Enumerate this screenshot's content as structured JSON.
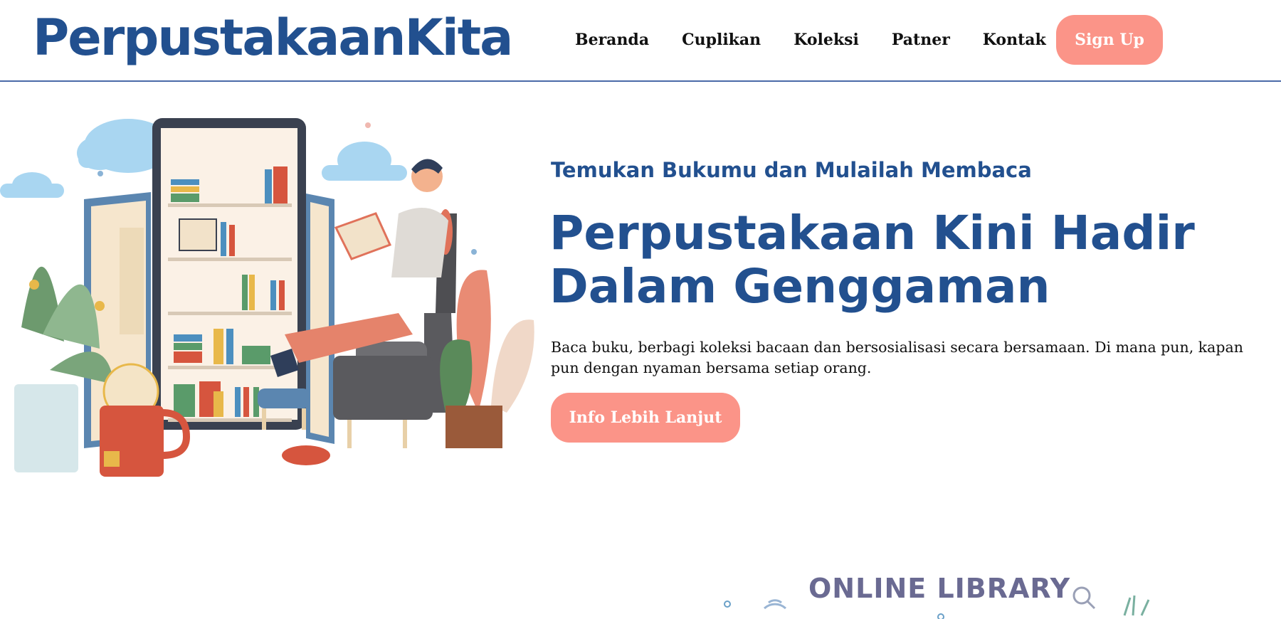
{
  "header": {
    "brand": "PerpustakaanKita",
    "nav": [
      "Beranda",
      "Cuplikan",
      "Koleksi",
      "Patner",
      "Kontak"
    ],
    "signup_label": "Sign Up"
  },
  "hero": {
    "eyebrow": "Temukan Bukumu dan Mulailah Membaca",
    "title": "Perpustakaan Kini Hadir Dalam Genggaman",
    "description": "Baca buku, berbagi koleksi bacaan dan bersosialisasi secara bersamaan. Di mana pun, kapan pun dengan nyaman bersama setiap orang.",
    "cta_label": "Info Lebih Lanjut"
  },
  "banner": {
    "text": "ONLINE LIBRARY"
  },
  "colors": {
    "brand_blue": "#22508f",
    "accent_salmon": "#fb9488",
    "divider": "#4a6aa8"
  }
}
